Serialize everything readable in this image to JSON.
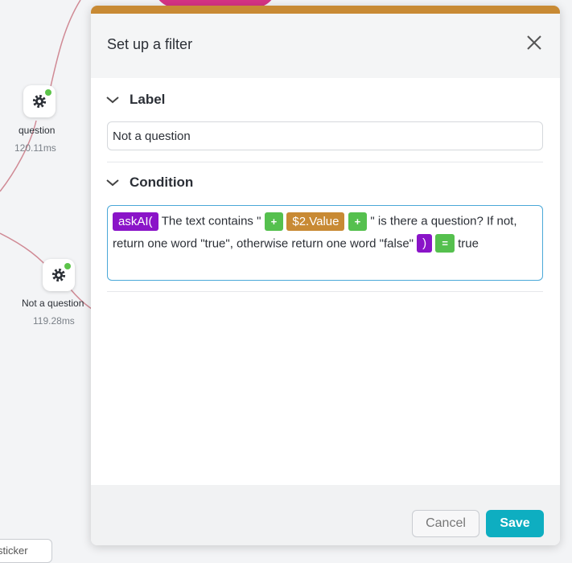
{
  "canvas": {
    "nodes": [
      {
        "label": "question",
        "time": "120.11ms",
        "icon": "gear-icon"
      },
      {
        "label": "Not a question",
        "time": "119.28ms",
        "icon": "gear-icon"
      }
    ],
    "sticker_label": "sticker"
  },
  "modal": {
    "title": "Set up a filter",
    "close_icon": "close-icon",
    "label_section": {
      "heading": "Label",
      "value": "Not a question"
    },
    "condition_section": {
      "heading": "Condition",
      "tokens": {
        "func": "askAI(",
        "text1": "The text contains \"",
        "plus": "+",
        "variable": "$2.Value",
        "text2": "\" is there a question? If not, return one word \"true\", otherwise return one word \"false\"",
        "close_paren": ")",
        "equals": "=",
        "result": "true"
      }
    },
    "footer": {
      "cancel_label": "Cancel",
      "save_label": "Save"
    }
  },
  "colors": {
    "accent_orange": "#c88a34",
    "token_purple": "#8a14c8",
    "token_green": "#55c04e",
    "save_teal": "#0eaec1",
    "status_green": "#5cc44a"
  }
}
